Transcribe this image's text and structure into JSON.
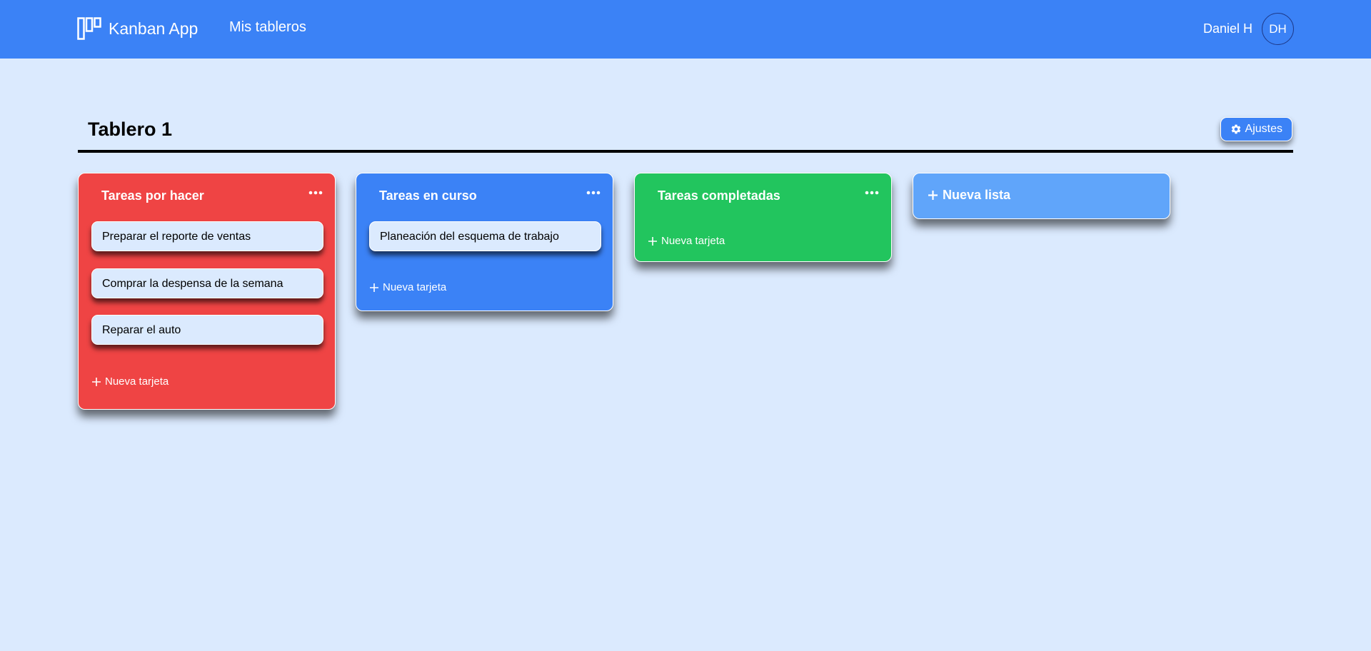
{
  "navbar": {
    "brand": "Kanban App",
    "nav_link": "Mis tableros",
    "user_name": "Daniel H",
    "avatar_initials": "DH"
  },
  "board": {
    "title": "Tablero 1",
    "settings_label": "Ajustes"
  },
  "lists": [
    {
      "title": "Tareas por hacer",
      "color": "#ef4444",
      "cards": [
        "Preparar el reporte de ventas",
        "Comprar la despensa de la semana",
        "Reparar el auto"
      ],
      "add_card_label": "Nueva tarjeta"
    },
    {
      "title": "Tareas en curso",
      "color": "#3b82f6",
      "cards": [
        "Planeación del esquema de trabajo"
      ],
      "add_card_label": "Nueva tarjeta"
    },
    {
      "title": "Tareas completadas",
      "color": "#22c55e",
      "cards": [],
      "add_card_label": "Nueva tarjeta"
    }
  ],
  "new_list_label": "Nueva lista",
  "colors": {
    "navbar": "#3b82f6",
    "background": "#dbeafe",
    "new_list": "#60a5fa"
  }
}
